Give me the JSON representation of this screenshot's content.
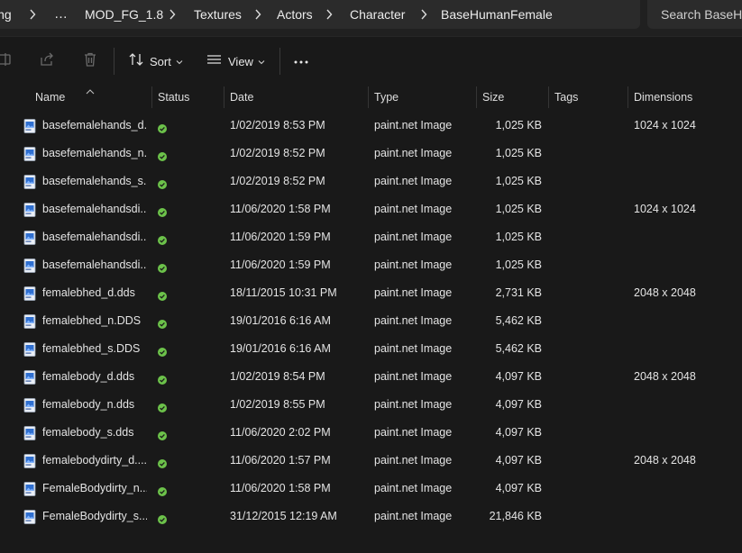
{
  "address": {
    "crumbs": [
      "ing",
      "MOD_FG_1.8",
      "Textures",
      "Actors",
      "Character",
      "BaseHumanFemale"
    ],
    "overflow_label": "…"
  },
  "search": {
    "placeholder": "Search BaseHumanFemale"
  },
  "toolbar": {
    "sort_label": "Sort",
    "view_label": "View",
    "more_label": "…"
  },
  "columns": {
    "name": "Name",
    "status": "Status",
    "date": "Date",
    "type": "Type",
    "size": "Size",
    "tags": "Tags",
    "dimensions": "Dimensions"
  },
  "status_color": "#6cc24a",
  "files": [
    {
      "name": "basefemalehands_d...",
      "date": "1/02/2019 8:53 PM",
      "type": "paint.net Image",
      "size": "1,025 KB",
      "dimensions": "1024 x 1024"
    },
    {
      "name": "basefemalehands_n...",
      "date": "1/02/2019 8:52 PM",
      "type": "paint.net Image",
      "size": "1,025 KB",
      "dimensions": ""
    },
    {
      "name": "basefemalehands_s...",
      "date": "1/02/2019 8:52 PM",
      "type": "paint.net Image",
      "size": "1,025 KB",
      "dimensions": ""
    },
    {
      "name": "basefemalehandsdi...",
      "date": "11/06/2020 1:58 PM",
      "type": "paint.net Image",
      "size": "1,025 KB",
      "dimensions": "1024 x 1024"
    },
    {
      "name": "basefemalehandsdi...",
      "date": "11/06/2020 1:59 PM",
      "type": "paint.net Image",
      "size": "1,025 KB",
      "dimensions": ""
    },
    {
      "name": "basefemalehandsdi...",
      "date": "11/06/2020 1:59 PM",
      "type": "paint.net Image",
      "size": "1,025 KB",
      "dimensions": ""
    },
    {
      "name": "femalebhed_d.dds",
      "date": "18/11/2015 10:31 PM",
      "type": "paint.net Image",
      "size": "2,731 KB",
      "dimensions": "2048 x 2048"
    },
    {
      "name": "femalebhed_n.DDS",
      "date": "19/01/2016 6:16 AM",
      "type": "paint.net Image",
      "size": "5,462 KB",
      "dimensions": ""
    },
    {
      "name": "femalebhed_s.DDS",
      "date": "19/01/2016 6:16 AM",
      "type": "paint.net Image",
      "size": "5,462 KB",
      "dimensions": ""
    },
    {
      "name": "femalebody_d.dds",
      "date": "1/02/2019 8:54 PM",
      "type": "paint.net Image",
      "size": "4,097 KB",
      "dimensions": "2048 x 2048"
    },
    {
      "name": "femalebody_n.dds",
      "date": "1/02/2019 8:55 PM",
      "type": "paint.net Image",
      "size": "4,097 KB",
      "dimensions": ""
    },
    {
      "name": "femalebody_s.dds",
      "date": "11/06/2020 2:02 PM",
      "type": "paint.net Image",
      "size": "4,097 KB",
      "dimensions": ""
    },
    {
      "name": "femalebodydirty_d....",
      "date": "11/06/2020 1:57 PM",
      "type": "paint.net Image",
      "size": "4,097 KB",
      "dimensions": "2048 x 2048"
    },
    {
      "name": "FemaleBodydirty_n....",
      "date": "11/06/2020 1:58 PM",
      "type": "paint.net Image",
      "size": "4,097 KB",
      "dimensions": ""
    },
    {
      "name": "FemaleBodydirty_s....",
      "date": "31/12/2015 12:19 AM",
      "type": "paint.net Image",
      "size": "21,846 KB",
      "dimensions": ""
    }
  ]
}
